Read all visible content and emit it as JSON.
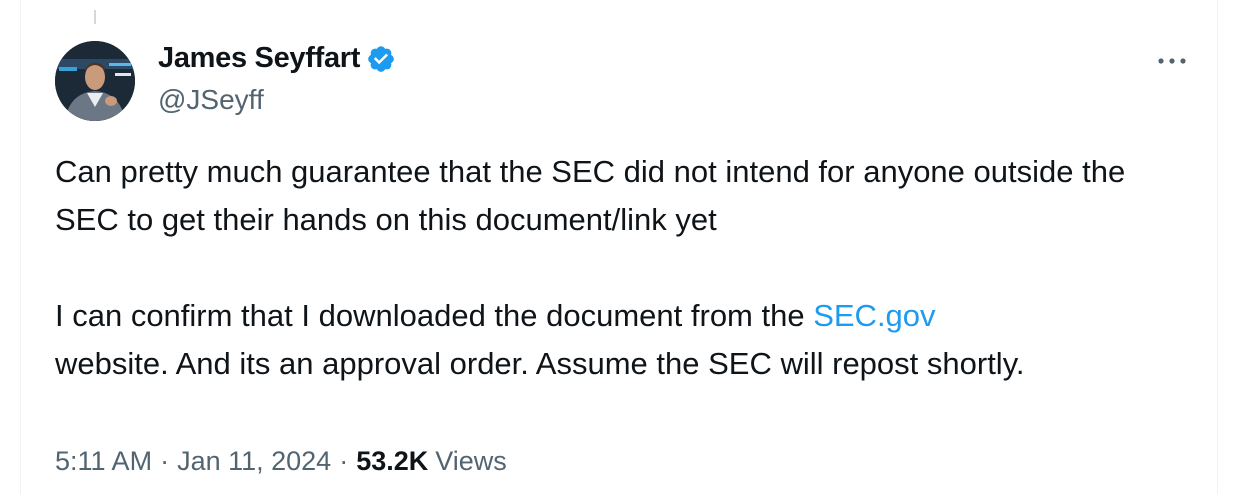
{
  "author": {
    "display_name": "James Seyffart",
    "handle": "@JSeyff",
    "verified": true
  },
  "tweet": {
    "paragraph1": "Can pretty much guarantee that the SEC did not intend for anyone outside the SEC to get their hands on this document/link yet",
    "paragraph2_before_link": "I can confirm that I downloaded the document from the ",
    "link_text": "SEC.gov",
    "paragraph2_after_link": " website. And its an approval order. Assume the SEC will repost shortly."
  },
  "meta": {
    "time": "5:11 AM",
    "date": "Jan 11, 2024",
    "separator": "·",
    "views_count": "53.2K",
    "views_label": "Views"
  },
  "colors": {
    "link": "#1d9bf0",
    "verified_badge": "#1d9bf0",
    "secondary_text": "#536471"
  },
  "icons": {
    "verified": "verified-badge-icon",
    "more": "more-horizontal-icon"
  }
}
